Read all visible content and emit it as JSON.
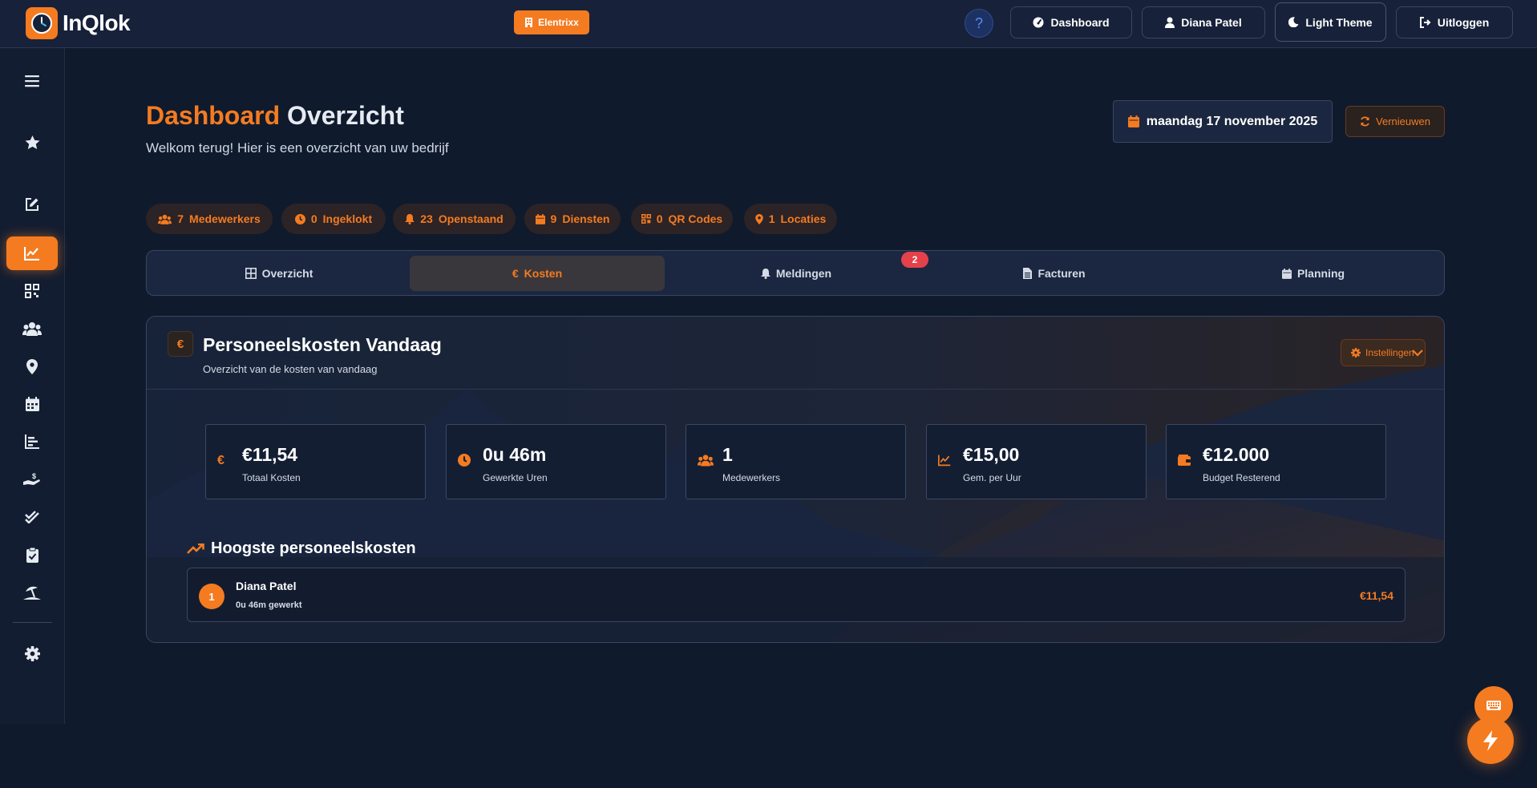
{
  "app": {
    "logo_text": "InQlok"
  },
  "topbar": {
    "company": "Elentrixx",
    "help": "?",
    "dashboard_label": "Dashboard",
    "user_label": "Diana Patel",
    "theme_label": "Light Theme",
    "logout_label": "Uitloggen"
  },
  "sidebar": {
    "items": [
      {
        "icon": "menu-icon"
      },
      {
        "icon": "star-icon"
      },
      {
        "icon": "edit-icon"
      },
      {
        "icon": "chart-line-icon",
        "active": true
      },
      {
        "icon": "qr-code-icon"
      },
      {
        "icon": "users-icon"
      },
      {
        "icon": "map-pin-icon"
      },
      {
        "icon": "calendar-icon"
      },
      {
        "icon": "bar-chart-icon"
      },
      {
        "icon": "hand-money-icon"
      },
      {
        "icon": "double-check-icon"
      },
      {
        "icon": "clipboard-check-icon"
      },
      {
        "icon": "umbrella-beach-icon"
      },
      {
        "icon": "gear-icon"
      }
    ]
  },
  "header": {
    "title_accent": "Dashboard",
    "title_rest": "Overzicht",
    "subtitle": "Welkom terug! Hier is een overzicht van uw bedrijf",
    "date": "maandag 17 november 2025",
    "refresh_label": "Vernieuwen"
  },
  "stats": [
    {
      "value": "7",
      "label": "Medewerkers",
      "icon": "users-icon"
    },
    {
      "value": "0",
      "label": "Ingeklokt",
      "icon": "clock-icon"
    },
    {
      "value": "23",
      "label": "Openstaand",
      "icon": "bell-icon"
    },
    {
      "value": "9",
      "label": "Diensten",
      "icon": "calendar-icon"
    },
    {
      "value": "0",
      "label": "QR Codes",
      "icon": "qr-code-icon"
    },
    {
      "value": "1",
      "label": "Locaties",
      "icon": "map-pin-icon"
    }
  ],
  "tabs": [
    {
      "label": "Overzicht",
      "icon": "grid-icon"
    },
    {
      "label": "Kosten",
      "icon": "euro-icon",
      "active": true
    },
    {
      "label": "Meldingen",
      "icon": "bell-icon",
      "badge": "2"
    },
    {
      "label": "Facturen",
      "icon": "document-icon"
    },
    {
      "label": "Planning",
      "icon": "calendar-icon"
    }
  ],
  "panel": {
    "badge": "€",
    "title": "Personeelskosten Vandaag",
    "subtitle": "Overzicht van de kosten van vandaag",
    "settings_label": "Instellingen",
    "metrics": [
      {
        "value": "€11,54",
        "label": "Totaal Kosten",
        "icon": "euro-icon"
      },
      {
        "value": "0u 46m",
        "label": "Gewerkte Uren",
        "icon": "clock-icon"
      },
      {
        "value": "1",
        "label": "Medewerkers",
        "icon": "users-icon"
      },
      {
        "value": "€15,00",
        "label": "Gem. per Uur",
        "icon": "chart-line-icon"
      },
      {
        "value": "€12.000",
        "label": "Budget Resterend",
        "icon": "wallet-icon"
      }
    ],
    "top_title": "Hoogste personeelskosten",
    "top_list": [
      {
        "rank": "1",
        "name": "Diana Patel",
        "hours": "0u 46m gewerkt",
        "cost": "€11,54"
      }
    ]
  },
  "colors": {
    "accent": "#f47b20",
    "background": "#101a2d",
    "badge_red": "#e5414b"
  }
}
